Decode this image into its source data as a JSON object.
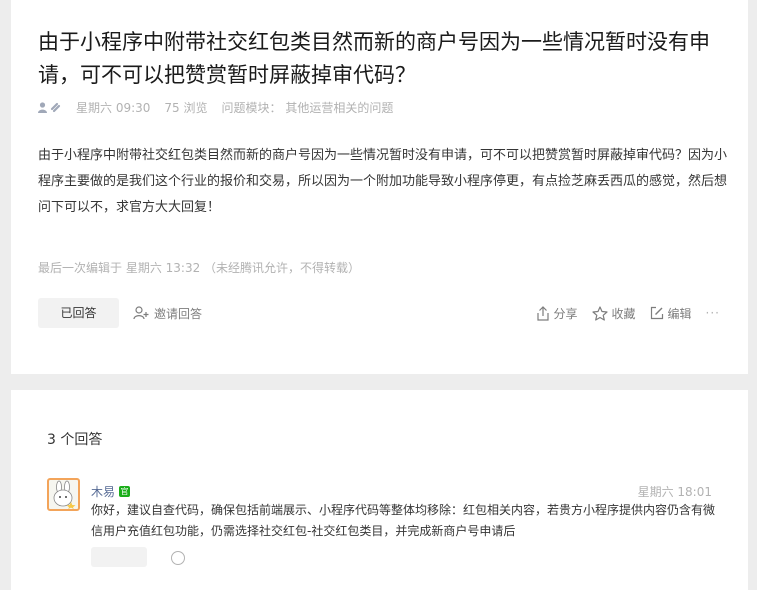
{
  "question": {
    "title": "由于小程序中附带社交红包类目然而新的商户号因为一些情况暂时没有申请，可不可以把赞赏暂时屏蔽掉审代码？",
    "time": "星期六 09:30",
    "views": "75 浏览",
    "module": "问题模块： 其他运营相关的问题",
    "body": "由于小程序中附带社交红包类目然而新的商户号因为一些情况暂时没有申请，可不可以把赞赏暂时屏蔽掉审代码？因为小程序主要做的是我们这个行业的报价和交易，所以因为一个附加功能导致小程序停更，有点捡芝麻丢西瓜的感觉，然后想问下可以不，求官方大大回复！",
    "edited": "最后一次编辑于  星期六 13:32  （未经腾讯允许，不得转载）",
    "answered_label": "已回答",
    "invite_label": "邀请回答",
    "share_label": "分享",
    "favorite_label": "收藏",
    "edit_label": "编辑",
    "more_label": "···"
  },
  "answers": {
    "count": "3 个回答",
    "first": {
      "author": "木易",
      "badge": "官",
      "time": "星期六 18:01",
      "text": "你好，建议自查代码，确保包括前端展示、小程序代码等整体均移除：红包相关内容，若贵方小程序提供内容仍含有微信用户充值红包功能，仍需选择社交红包-社交红包类目，并完成新商户号申请后"
    }
  },
  "colors": {
    "accent": "#576b95",
    "badge": "#1aad19",
    "muted": "#b2b2b2",
    "background": "#ededed"
  }
}
